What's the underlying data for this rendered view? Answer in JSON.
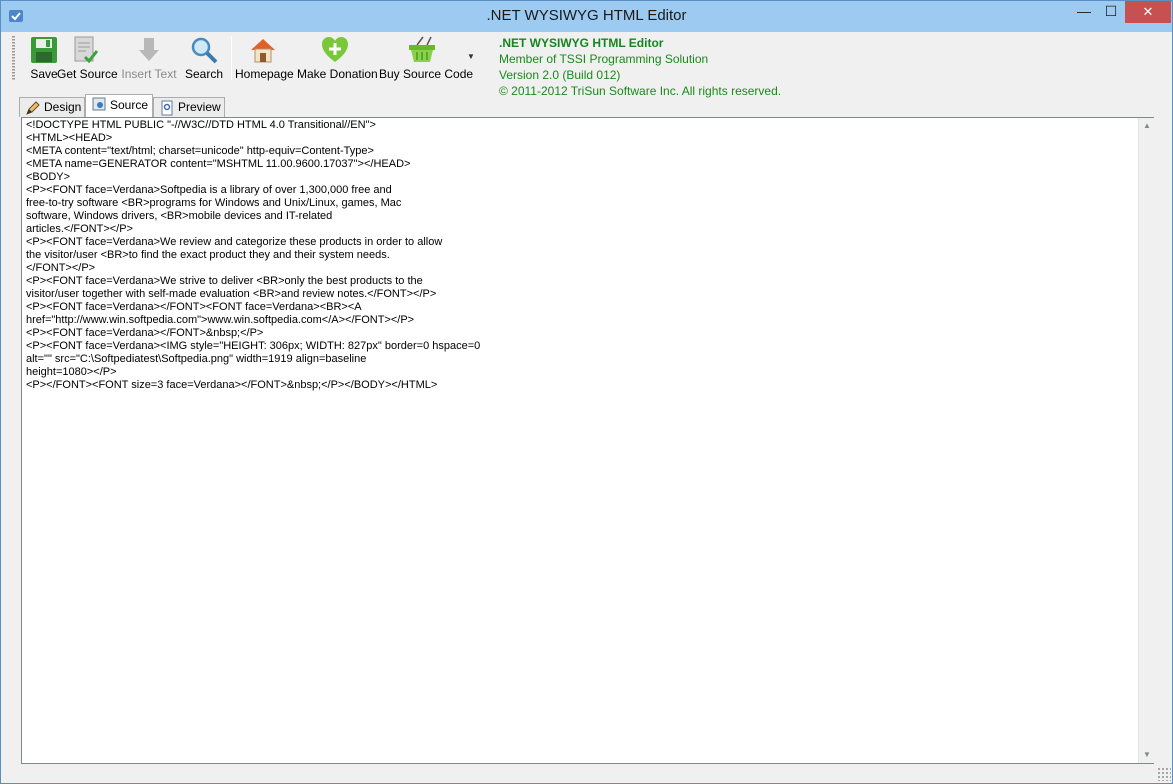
{
  "window": {
    "title": ".NET WYSIWYG HTML Editor",
    "minimize_glyph": "—",
    "maximize_glyph": "☐",
    "close_glyph": "✕"
  },
  "toolbar": {
    "save_label": "Save",
    "get_source_label": "Get Source",
    "insert_text_label": "Insert Text",
    "search_label": "Search",
    "homepage_label": "Homepage",
    "make_donation_label": "Make Donation",
    "buy_source_label": "Buy Source Code",
    "dropdown_glyph": "▼"
  },
  "info": {
    "line1": ".NET WYSIWYG HTML Editor",
    "line2": "Member of TSSI Programming Solution",
    "line3": "Version 2.0 (Build 012)",
    "line4": "© 2011-2012 TriSun Software Inc. All rights reserved."
  },
  "tabs": {
    "design": "Design",
    "source": "Source",
    "preview": "Preview",
    "active": "source"
  },
  "editor": {
    "lines": [
      "<!DOCTYPE HTML PUBLIC \"-//W3C//DTD HTML 4.0 Transitional//EN\">",
      "<HTML><HEAD>",
      "<META content=\"text/html; charset=unicode\" http-equiv=Content-Type>",
      "<META name=GENERATOR content=\"MSHTML 11.00.9600.17037\"></HEAD>",
      "<BODY>",
      "<P><FONT face=Verdana>Softpedia is a library of over 1,300,000 free and",
      "free-to-try software <BR>programs for Windows and Unix/Linux, games, Mac",
      "software, Windows drivers, <BR>mobile devices and IT-related",
      "articles.</FONT></P>",
      "<P><FONT face=Verdana>We review and categorize these products in order to allow",
      "the visitor/user <BR>to find the exact product they and their system needs.",
      "</FONT></P>",
      "<P><FONT face=Verdana>We strive to deliver <BR>only the best products to the",
      "visitor/user together with self-made evaluation <BR>and review notes.</FONT></P>",
      "<P><FONT face=Verdana></FONT><FONT face=Verdana><BR><A",
      "href=\"http://www.win.softpedia.com\">www.win.softpedia.com</A></FONT></P>",
      "<P><FONT face=Verdana></FONT>&nbsp;</P>",
      "<P><FONT face=Verdana><IMG style=\"HEIGHT: 306px; WIDTH: 827px\" border=0 hspace=0",
      "alt=\"\" src=\"C:\\Softpediatest\\Softpedia.png\" width=1919 align=baseline",
      "height=1080></P>",
      "<P></FONT><FONT size=3 face=Verdana></FONT>&nbsp;</P></BODY></HTML>"
    ]
  },
  "scrollbar": {
    "up_glyph": "▲",
    "down_glyph": "▼"
  }
}
